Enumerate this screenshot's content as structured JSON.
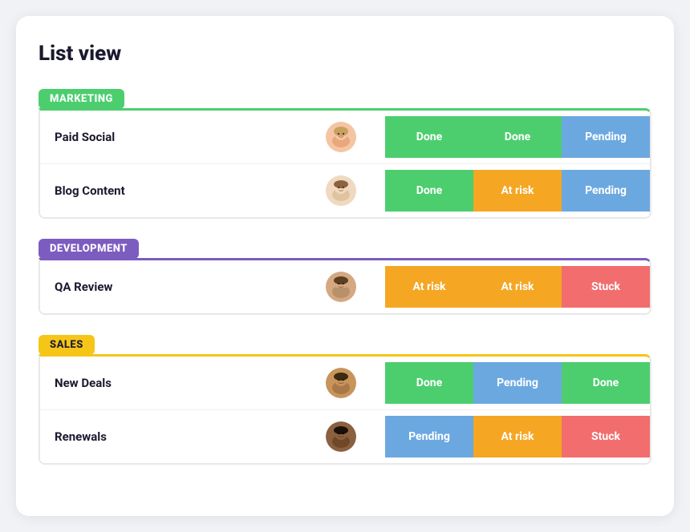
{
  "title": "List view",
  "groups": [
    {
      "id": "marketing",
      "label": "MARKETING",
      "colorClass": "group-marketing",
      "rows": [
        {
          "label": "Paid Social",
          "avatarType": "woman1",
          "statuses": [
            {
              "label": "Done",
              "class": "status-done"
            },
            {
              "label": "Done",
              "class": "status-done"
            },
            {
              "label": "Pending",
              "class": "status-pending"
            }
          ]
        },
        {
          "label": "Blog Content",
          "avatarType": "woman2",
          "statuses": [
            {
              "label": "Done",
              "class": "status-done"
            },
            {
              "label": "At risk",
              "class": "status-at-risk"
            },
            {
              "label": "Pending",
              "class": "status-pending"
            }
          ]
        }
      ]
    },
    {
      "id": "development",
      "label": "DEVELOPMENT",
      "colorClass": "group-development",
      "rows": [
        {
          "label": "QA Review",
          "avatarType": "man1",
          "statuses": [
            {
              "label": "At risk",
              "class": "status-at-risk"
            },
            {
              "label": "At risk",
              "class": "status-at-risk"
            },
            {
              "label": "Stuck",
              "class": "status-stuck"
            }
          ]
        }
      ]
    },
    {
      "id": "sales",
      "label": "SALES",
      "colorClass": "group-sales",
      "rows": [
        {
          "label": "New Deals",
          "avatarType": "man2",
          "statuses": [
            {
              "label": "Done",
              "class": "status-done"
            },
            {
              "label": "Pending",
              "class": "status-pending"
            },
            {
              "label": "Done",
              "class": "status-done"
            }
          ]
        },
        {
          "label": "Renewals",
          "avatarType": "man3",
          "statuses": [
            {
              "label": "Pending",
              "class": "status-pending"
            },
            {
              "label": "At risk",
              "class": "status-at-risk"
            },
            {
              "label": "Stuck",
              "class": "status-stuck"
            }
          ]
        }
      ]
    }
  ]
}
